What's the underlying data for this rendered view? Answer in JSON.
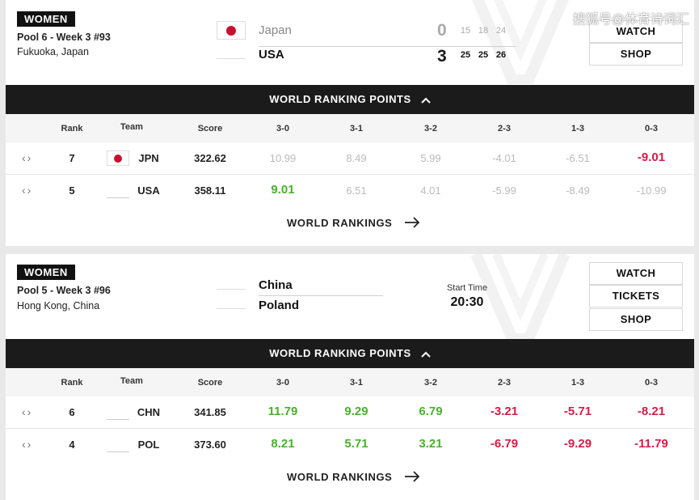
{
  "watermark": "搜狐号@体育诗词汇",
  "world_ranking_points_label": "WORLD RANKING POINTS",
  "world_rankings_link": "WORLD RANKINGS",
  "columns": [
    "Rank",
    "Team",
    "Score",
    "3-0",
    "3-1",
    "3-2",
    "2-3",
    "1-3",
    "0-3"
  ],
  "matches": [
    {
      "category": "WOMEN",
      "pool": "Pool 6 - Week 3 #93",
      "location": "Fukuoka, Japan",
      "teams": [
        {
          "name": "Japan",
          "score": "0",
          "sets": [
            "15",
            "18",
            "24"
          ]
        },
        {
          "name": "USA",
          "score": "3",
          "sets": [
            "25",
            "25",
            "26"
          ]
        }
      ],
      "buttons": [
        "WATCH",
        "SHOP"
      ],
      "rows": [
        {
          "rank": "7",
          "team": "JPN",
          "score": "322.62",
          "points": [
            "10.99",
            "8.49",
            "5.99",
            "-4.01",
            "-6.51",
            "-9.01"
          ]
        },
        {
          "rank": "5",
          "team": "USA",
          "score": "358.11",
          "points": [
            "9.01",
            "6.51",
            "4.01",
            "-5.99",
            "-8.49",
            "-10.99"
          ]
        }
      ]
    },
    {
      "category": "WOMEN",
      "pool": "Pool 5 - Week 3 #96",
      "location": "Hong Kong, China",
      "teams": [
        {
          "name": "China"
        },
        {
          "name": "Poland"
        }
      ],
      "start_label": "Start Time",
      "start_time": "20:30",
      "buttons": [
        "WATCH",
        "TICKETS",
        "SHOP"
      ],
      "rows": [
        {
          "rank": "6",
          "team": "CHN",
          "score": "341.85",
          "points": [
            "11.79",
            "9.29",
            "6.79",
            "-3.21",
            "-5.71",
            "-8.21"
          ]
        },
        {
          "rank": "4",
          "team": "POL",
          "score": "373.60",
          "points": [
            "8.21",
            "5.71",
            "3.21",
            "-6.79",
            "-9.29",
            "-11.79"
          ]
        }
      ]
    }
  ],
  "colors": {
    "positive": "#4caf2e",
    "negative": "#d81b48",
    "muted": "#bbbbbb",
    "bar": "#1b1b1b"
  }
}
